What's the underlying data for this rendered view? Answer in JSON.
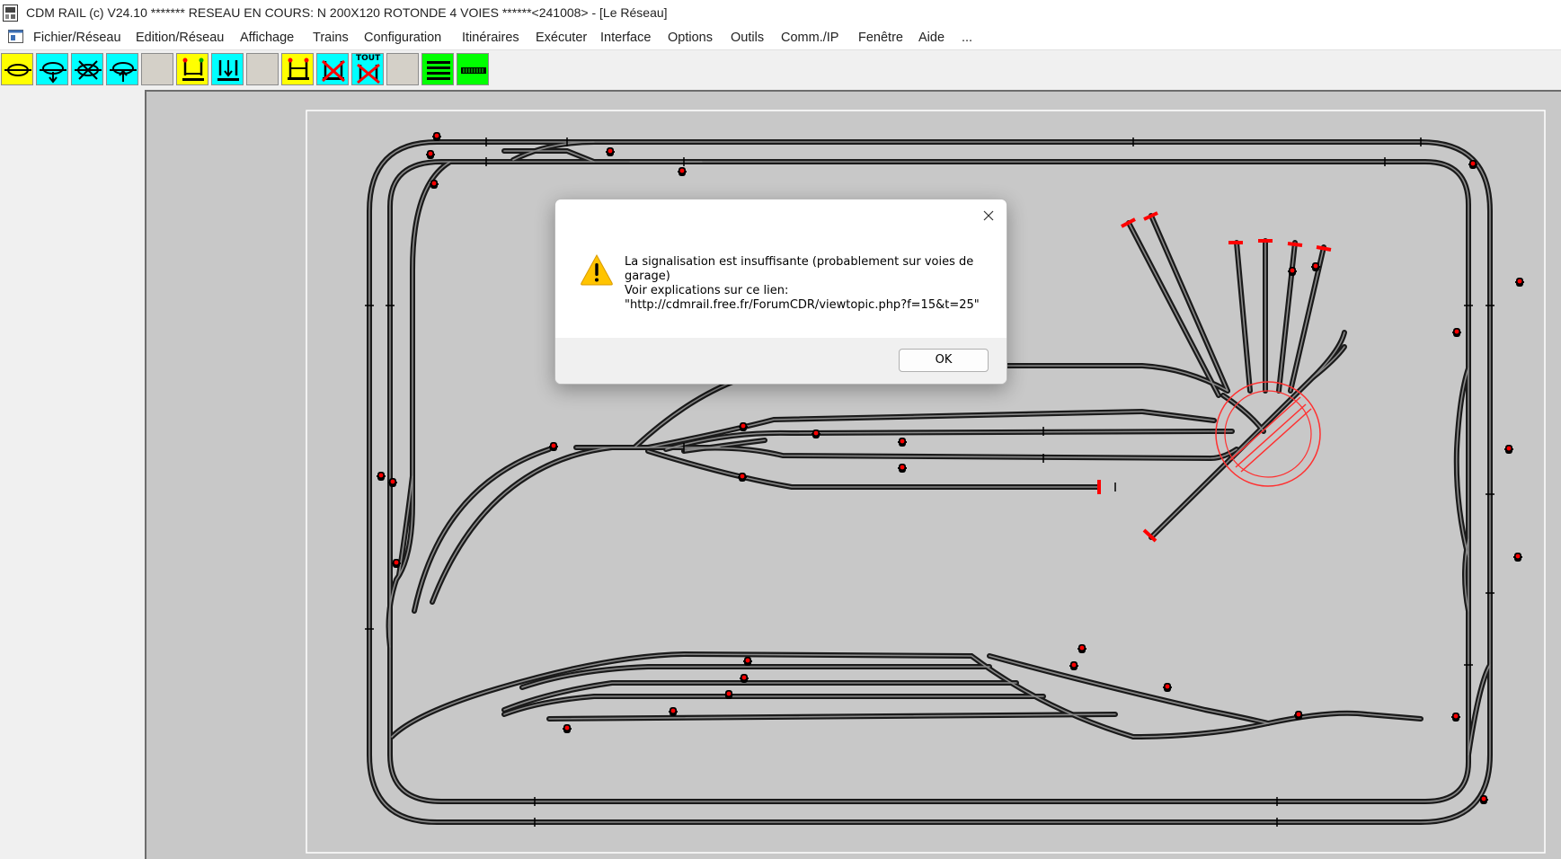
{
  "window": {
    "title": "CDM RAIL (c) V24.10      ******* RESEAU EN COURS: N 200X120 ROTONDE 4 VOIES ******<241008> - [Le Réseau]"
  },
  "menu": {
    "items": [
      "Fichier/Réseau",
      "Edition/Réseau",
      "Affichage",
      "Trains",
      "Configuration",
      "Itinéraires",
      "Exécuter",
      "Interface",
      "Options",
      "Outils",
      "Comm./IP",
      "Fenêtre",
      "Aide",
      "..."
    ]
  },
  "toolbar": {
    "tout_label": "TOUT",
    "colors": {
      "yellow": "#ffff00",
      "cyan": "#00ffff",
      "green": "#00ff00",
      "gray": "#d4d0c8"
    }
  },
  "dialog": {
    "message_lines": [
      "La signalisation est insuffisante (probablement sur voies de",
      "garage)",
      "Voir explications sur ce lien:",
      "\"http://cdmrail.free.fr/ForumCDR/viewtopic.php?f=15&t=25\""
    ],
    "ok_label": "OK",
    "icon": "warning-icon",
    "close_icon": "close-icon"
  },
  "colors": {
    "canvas_bg": "#c8c8c8",
    "track": "#1a1a1a",
    "rail": "#8a8a8a",
    "signal_red": "#ff0000",
    "turntable": "#ff3030"
  }
}
